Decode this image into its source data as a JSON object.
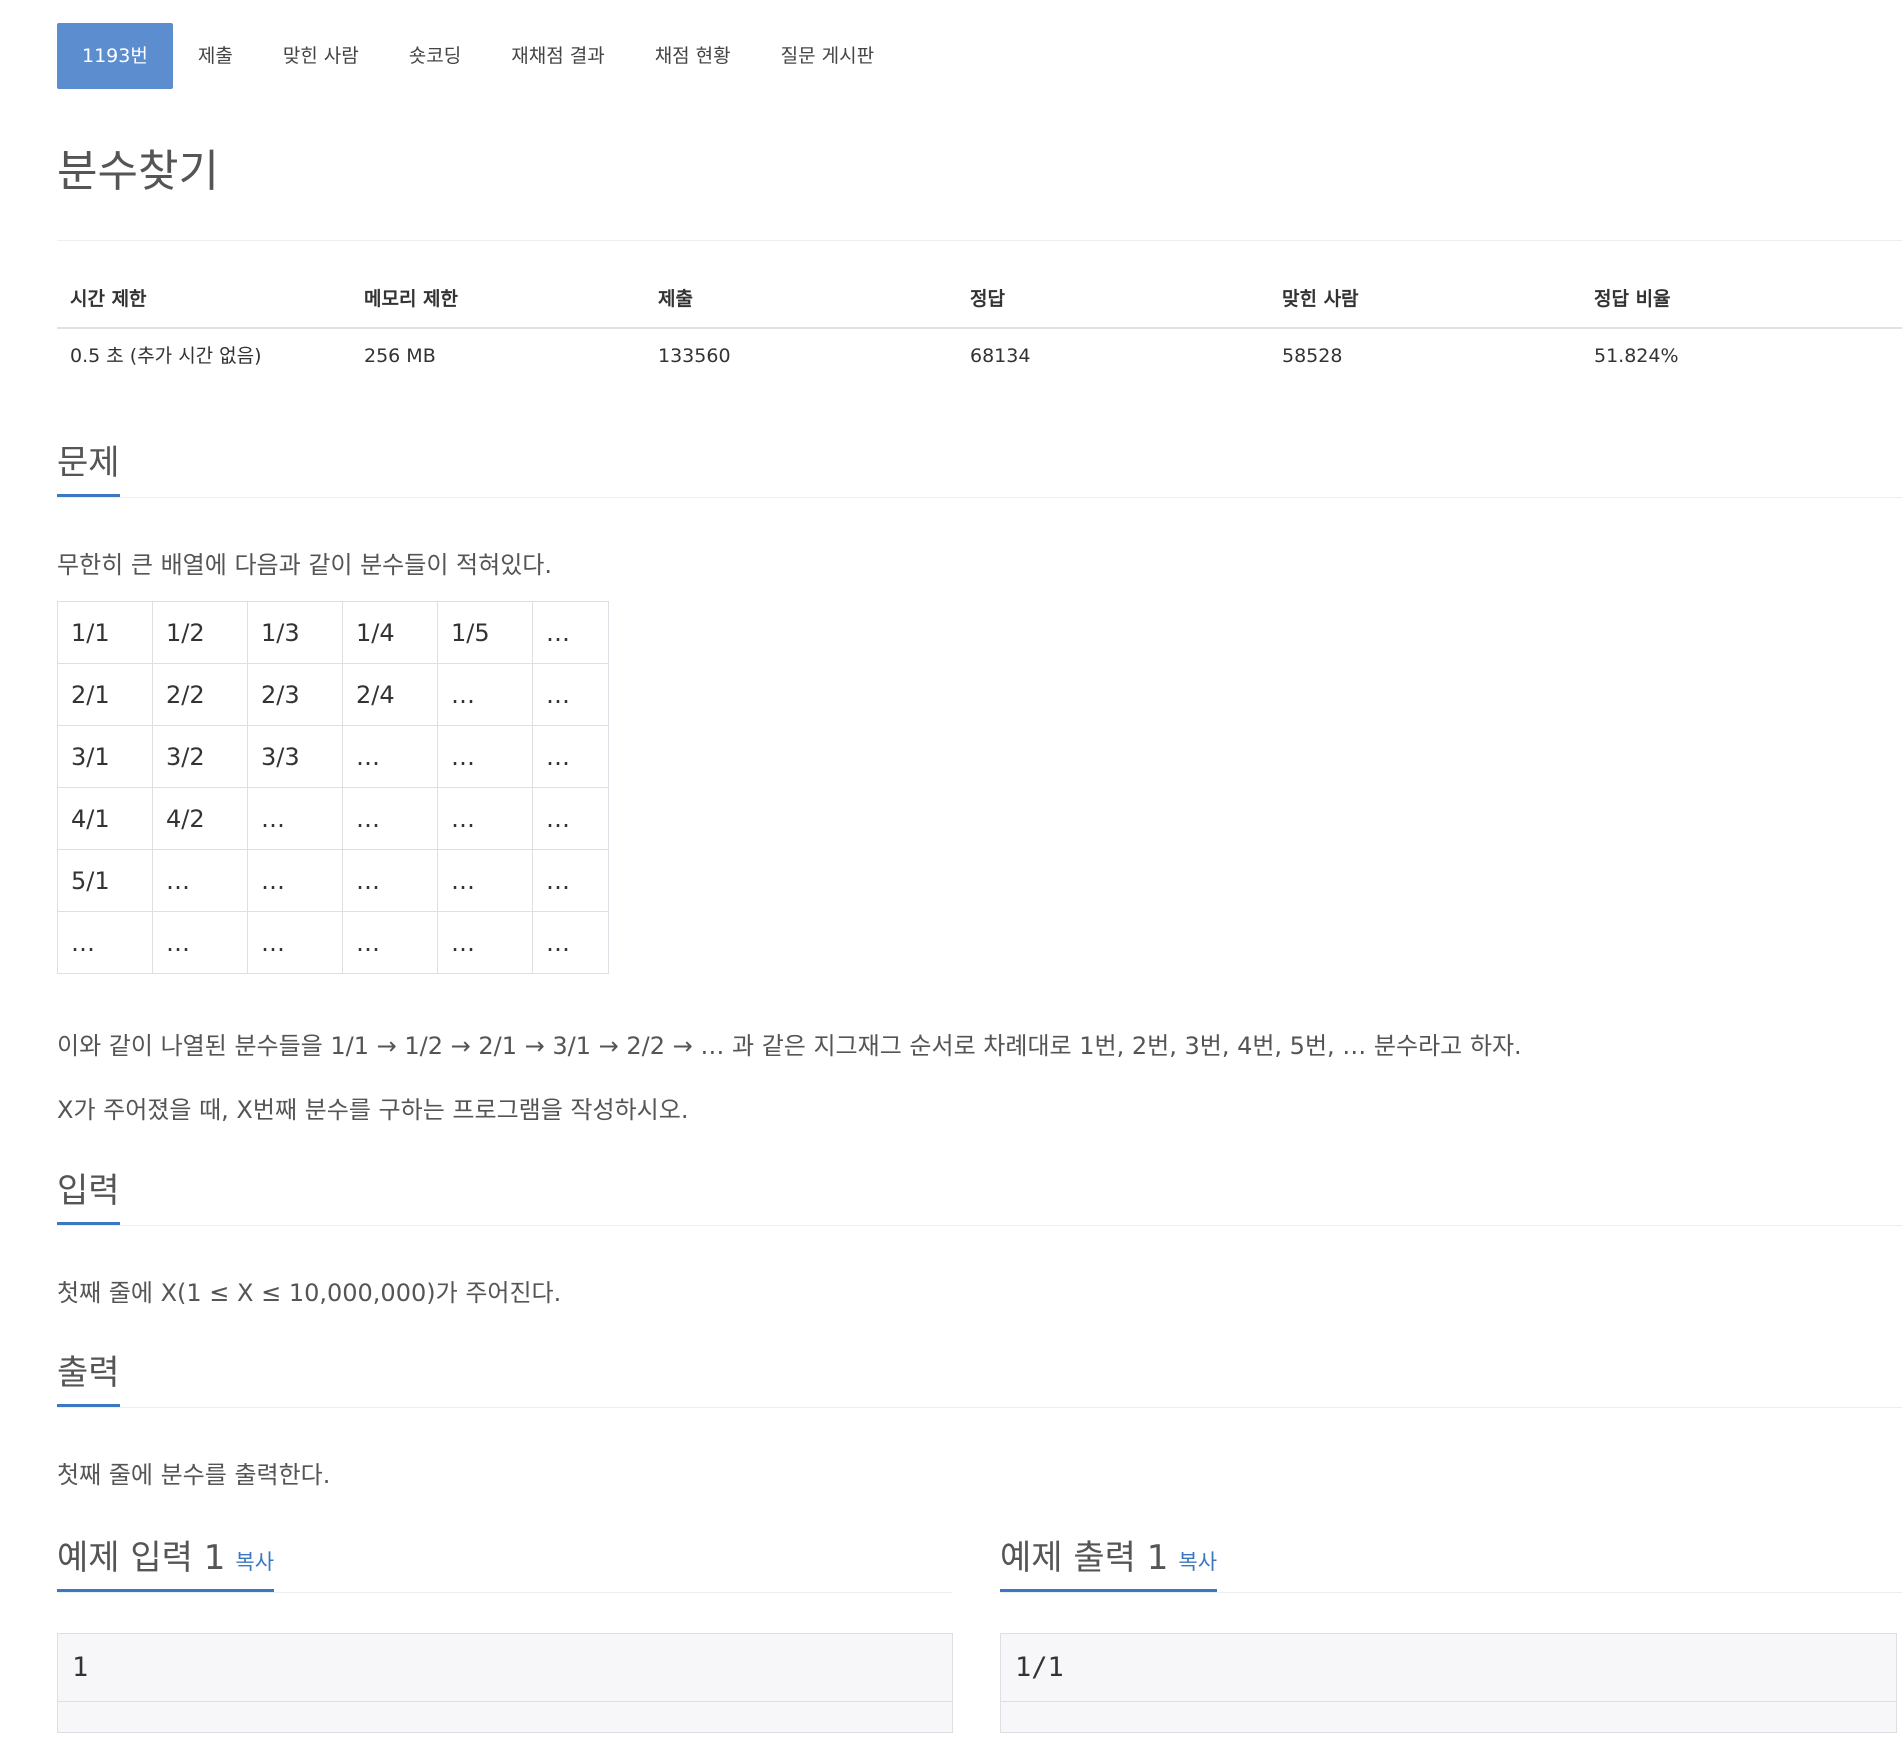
{
  "tabs": [
    {
      "label": "1193번",
      "active": true
    },
    {
      "label": "제출"
    },
    {
      "label": "맞힌 사람"
    },
    {
      "label": "숏코딩"
    },
    {
      "label": "재채점 결과"
    },
    {
      "label": "채점 현황"
    },
    {
      "label": "질문 게시판"
    }
  ],
  "problem_title": "분수찾기",
  "stats": {
    "headers": [
      "시간 제한",
      "메모리 제한",
      "제출",
      "정답",
      "맞힌 사람",
      "정답 비율"
    ],
    "values": [
      "0.5 초 (추가 시간 없음)",
      "256 MB",
      "133560",
      "68134",
      "58528",
      "51.824%"
    ]
  },
  "sections": {
    "problem": {
      "heading": "문제",
      "intro": "무한히 큰 배열에 다음과 같이 분수들이 적혀있다.",
      "grid": [
        [
          "1/1",
          "1/2",
          "1/3",
          "1/4",
          "1/5",
          "…"
        ],
        [
          "2/1",
          "2/2",
          "2/3",
          "2/4",
          "…",
          "…"
        ],
        [
          "3/1",
          "3/2",
          "3/3",
          "…",
          "…",
          "…"
        ],
        [
          "4/1",
          "4/2",
          "…",
          "…",
          "…",
          "…"
        ],
        [
          "5/1",
          "…",
          "…",
          "…",
          "…",
          "…"
        ],
        [
          "…",
          "…",
          "…",
          "…",
          "…",
          "…"
        ]
      ],
      "desc1": "이와 같이 나열된 분수들을 1/1 → 1/2 → 2/1 → 3/1 → 2/2 → … 과 같은 지그재그 순서로 차례대로 1번, 2번, 3번, 4번, 5번, … 분수라고 하자.",
      "desc2": "X가 주어졌을 때, X번째 분수를 구하는 프로그램을 작성하시오."
    },
    "input": {
      "heading": "입력",
      "text": "첫째 줄에 X(1 ≤ X ≤ 10,000,000)가 주어진다."
    },
    "output": {
      "heading": "출력",
      "text": "첫째 줄에 분수를 출력한다."
    }
  },
  "samples": {
    "input": {
      "heading": "예제 입력 1",
      "copy_label": "복사",
      "content": "1"
    },
    "output": {
      "heading": "예제 출력 1",
      "copy_label": "복사",
      "content": "1/1"
    }
  },
  "colors": {
    "accent": "#3b78c1",
    "active_tab": "#5b8dcf"
  }
}
